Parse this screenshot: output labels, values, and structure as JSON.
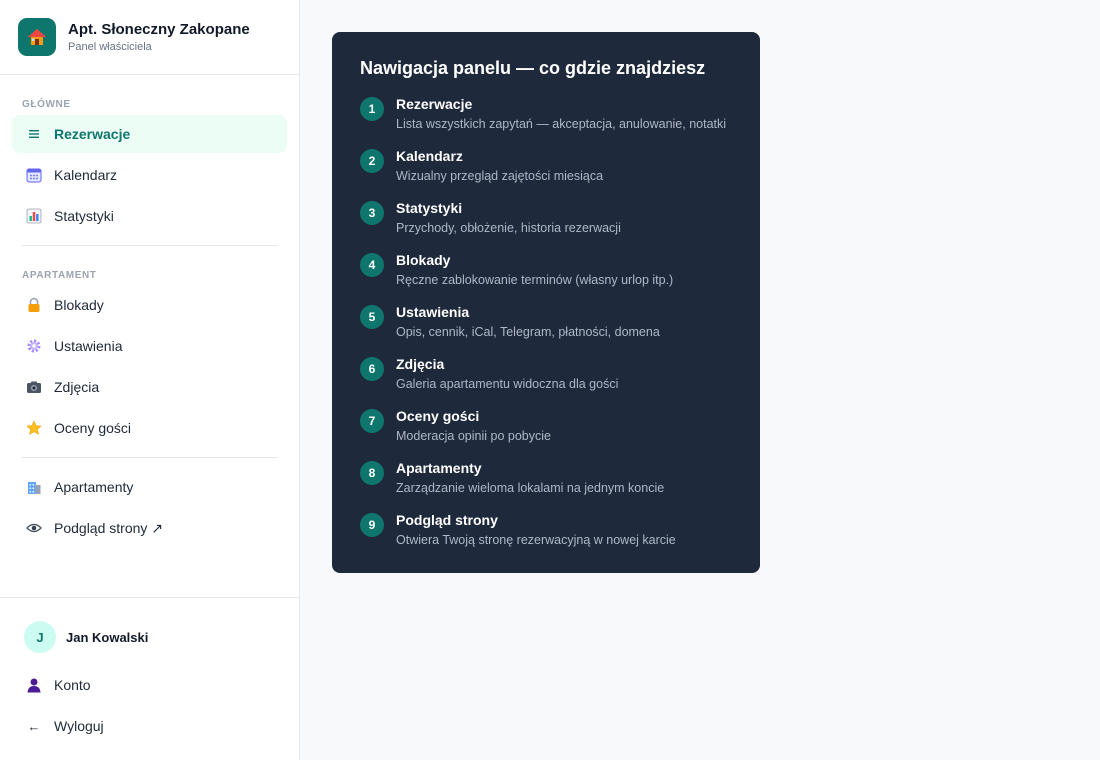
{
  "brand": {
    "title": "Apt. Słoneczny Zakopane",
    "subtitle": "Panel właściciela",
    "icon": "house-icon"
  },
  "sidebar": {
    "sections": [
      {
        "label": "GŁÓWNE"
      },
      {
        "label": "APARTAMENT"
      }
    ],
    "items": [
      {
        "label": "Rezerwacje",
        "icon": "list-icon",
        "active": true
      },
      {
        "label": "Kalendarz",
        "icon": "calendar-icon"
      },
      {
        "label": "Statystyki",
        "icon": "bar-chart-icon"
      },
      {
        "label": "Blokady",
        "icon": "lock-icon"
      },
      {
        "label": "Ustawienia",
        "icon": "gear-icon"
      },
      {
        "label": "Zdjęcia",
        "icon": "camera-icon"
      },
      {
        "label": "Oceny gości",
        "icon": "star-icon"
      },
      {
        "label": "Apartamenty",
        "icon": "building-icon"
      },
      {
        "label": "Podgląd strony ↗",
        "icon": "eye-icon"
      }
    ]
  },
  "user": {
    "initial": "J",
    "name": "Jan Kowalski"
  },
  "footer": {
    "account_label": "Konto",
    "logout_label": "Wyloguj",
    "logout_icon_text": "←"
  },
  "help": {
    "title": "Nawigacja panelu — co gdzie znajdziesz",
    "steps": [
      {
        "num": "1",
        "title": "Rezerwacje",
        "desc": "Lista wszystkich zapytań — akceptacja, anulowanie, notatki"
      },
      {
        "num": "2",
        "title": "Kalendarz",
        "desc": "Wizualny przegląd zajętości miesiąca"
      },
      {
        "num": "3",
        "title": "Statystyki",
        "desc": "Przychody, obłożenie, historia rezerwacji"
      },
      {
        "num": "4",
        "title": "Blokady",
        "desc": "Ręczne zablokowanie terminów (własny urlop itp.)"
      },
      {
        "num": "5",
        "title": "Ustawienia",
        "desc": "Opis, cennik, iCal, Telegram, płatności, domena"
      },
      {
        "num": "6",
        "title": "Zdjęcia",
        "desc": "Galeria apartamentu widoczna dla gości"
      },
      {
        "num": "7",
        "title": "Oceny gości",
        "desc": "Moderacja opinii po pobycie"
      },
      {
        "num": "8",
        "title": "Apartamenty",
        "desc": "Zarządzanie wieloma lokalami na jednym koncie"
      },
      {
        "num": "9",
        "title": "Podgląd strony",
        "desc": "Otwiera Twoją stronę rezerwacyjną w nowej karcie"
      }
    ]
  },
  "colors": {
    "accent": "#0f766e",
    "active_bg": "#ecfdf5",
    "card_bg": "#1e293b",
    "card_desc": "#aeb8c6"
  }
}
